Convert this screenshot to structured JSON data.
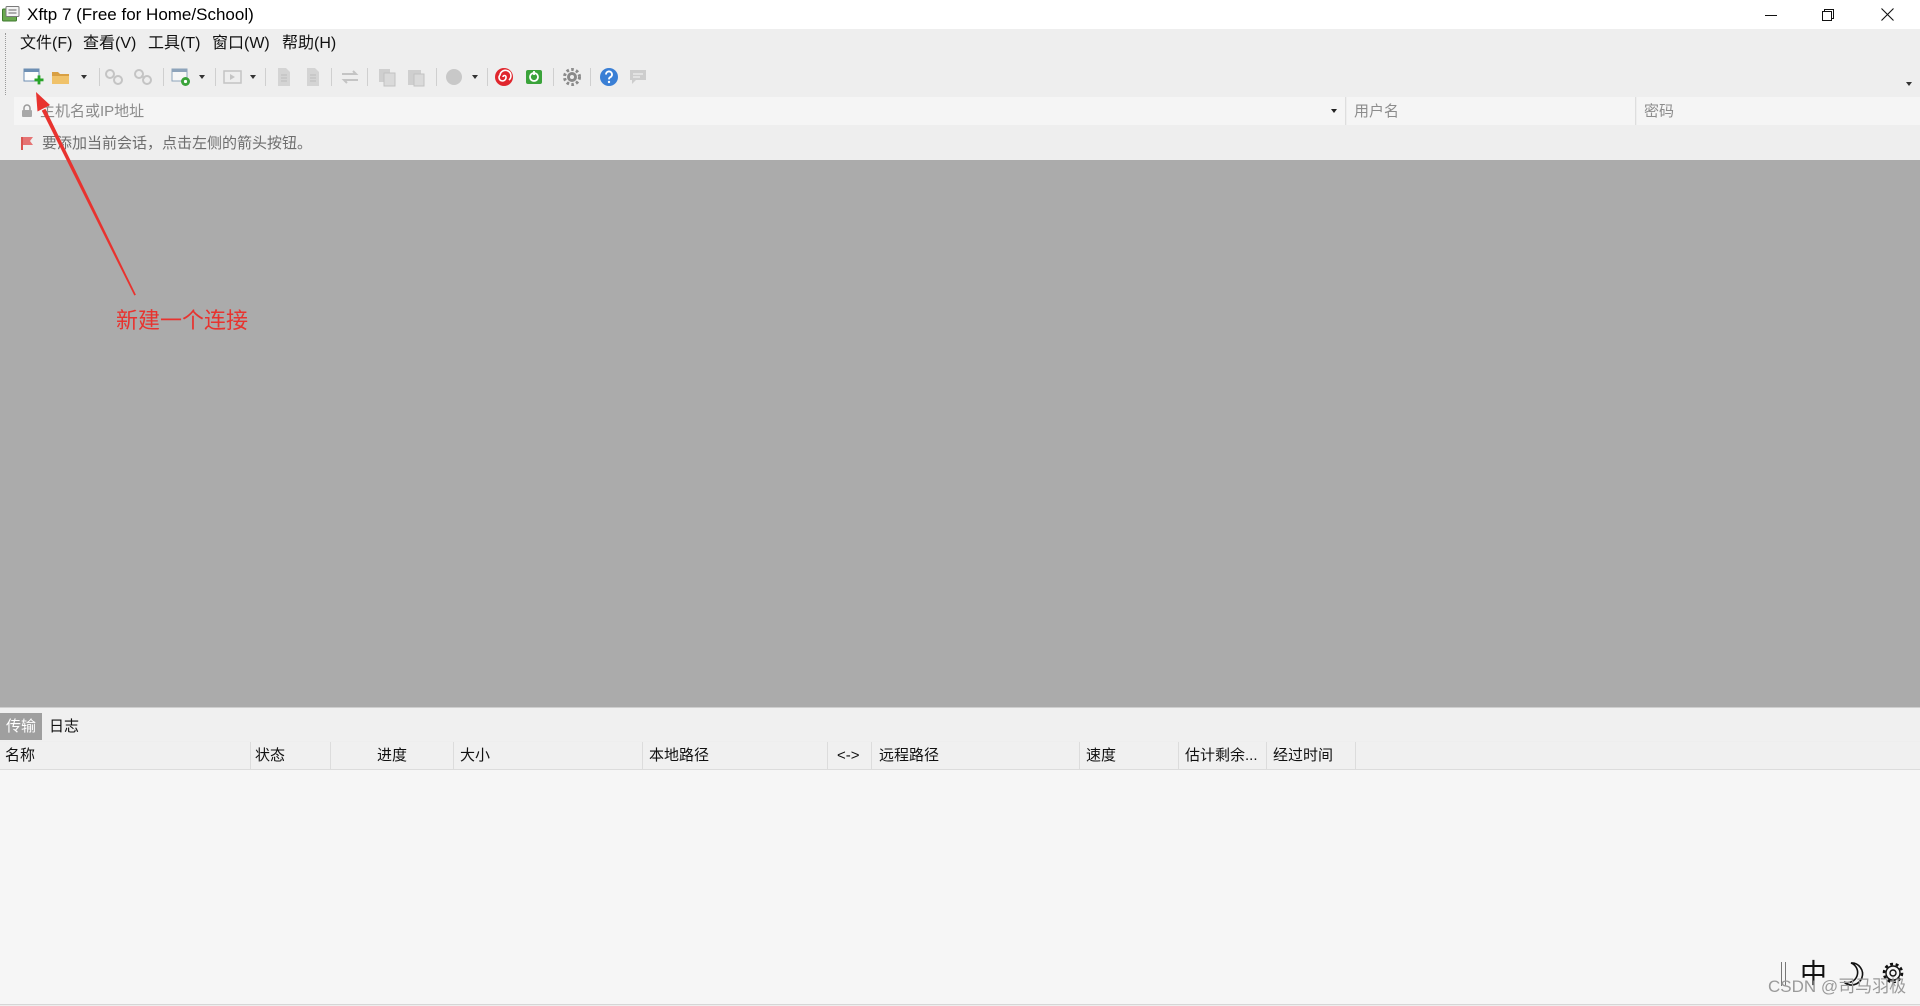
{
  "window": {
    "title": "Xftp 7 (Free for Home/School)"
  },
  "menu": [
    {
      "label": "文件(F)"
    },
    {
      "label": "查看(V)"
    },
    {
      "label": "工具(T)"
    },
    {
      "label": "窗口(W)"
    },
    {
      "label": "帮助(H)"
    }
  ],
  "toolbar": {
    "icons": [
      "new-session-icon",
      "open-folder-icon",
      "disconnect-icon",
      "reconnect-icon",
      "new-window-icon",
      "terminal-icon",
      "document-icon",
      "document-icon",
      "transfer-icon",
      "copy-icon",
      "paste-icon",
      "globe-icon",
      "xshell-icon",
      "xftp-icon",
      "gear-icon",
      "help-icon",
      "chat-icon"
    ]
  },
  "address_bar": {
    "host_placeholder": "主机名或IP地址",
    "username_placeholder": "用户名",
    "password_placeholder": "密码"
  },
  "links_bar": {
    "hint": "要添加当前会话，点击左侧的箭头按钮。"
  },
  "annotation": {
    "text": "新建一个连接"
  },
  "bottom_tabs": [
    {
      "label": "传输",
      "selected": true
    },
    {
      "label": "日志",
      "selected": false
    }
  ],
  "transfer": {
    "columns": [
      "名称",
      "状态",
      "进度",
      "大小",
      "本地路径",
      "<->",
      "远程路径",
      "速度",
      "估计剩余...",
      "经过时间"
    ]
  },
  "ime": {
    "mode": "中"
  },
  "watermark": "CSDN @司马羽极",
  "colors": {
    "workspace": "#ababab",
    "annotation": "#e8332f",
    "selected_tab": "#9f9f9f",
    "help": "#3a7fd5",
    "xshell": "#e0262d",
    "xftp": "#3aa33a"
  }
}
